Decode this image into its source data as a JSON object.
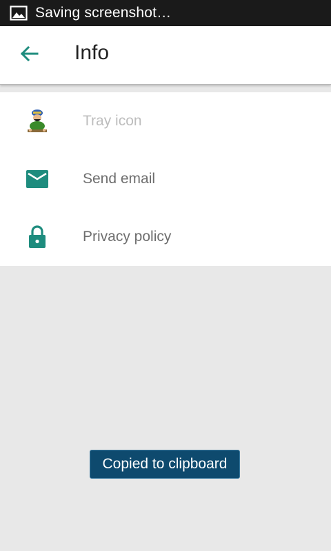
{
  "status_bar": {
    "icon": "image-icon",
    "text": "Saving screenshot…"
  },
  "app_bar": {
    "back_icon": "arrow-back-icon",
    "title": "Info",
    "accent": "#1e8c7e"
  },
  "list": {
    "items": [
      {
        "label": "Tray icon",
        "icon": "tray-character-icon",
        "enabled": false
      },
      {
        "label": "Send email",
        "icon": "envelope-icon",
        "enabled": true
      },
      {
        "label": "Privacy policy",
        "icon": "lock-icon",
        "enabled": true
      }
    ]
  },
  "toast": {
    "text": "Copied to clipboard"
  },
  "colors": {
    "status_bar_bg": "#1a1a1a",
    "icon_teal": "#1e8c7e",
    "background": "#e8e8e8",
    "toast_bg": "#0e4a6e"
  }
}
